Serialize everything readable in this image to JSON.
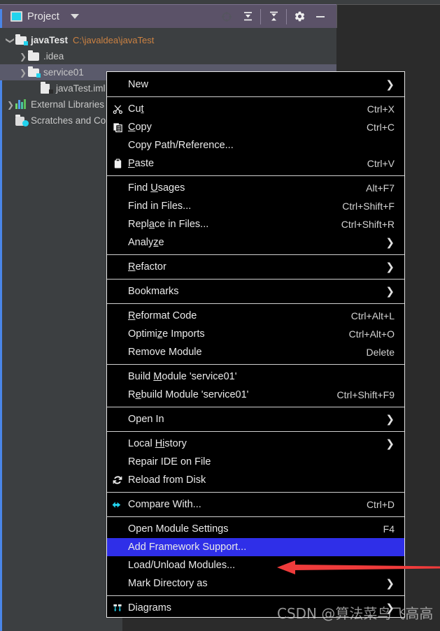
{
  "window": {
    "tool_window_title": "Project",
    "header_icons": [
      {
        "name": "locate-icon",
        "glyph": "target"
      },
      {
        "name": "collapse-all-icon",
        "glyph": "collapse"
      },
      {
        "name": "expand-all-icon",
        "glyph": "expand"
      },
      {
        "name": "settings-gear-icon",
        "glyph": "gear"
      },
      {
        "name": "hide-icon",
        "glyph": "minus"
      }
    ],
    "accent_color": "#4a86e8",
    "header_bg": "#5b5268",
    "panel_bg": "#3c3f41"
  },
  "project_tree": [
    {
      "label": "javaTest",
      "path": "C:\\javaldea\\javaTest",
      "icon": "module-folder-icon",
      "indent": 0,
      "chevron": "open",
      "bold": true,
      "selected": false
    },
    {
      "label": ".idea",
      "path": "",
      "icon": "folder-icon",
      "indent": 1,
      "chevron": "closed",
      "bold": false,
      "selected": false
    },
    {
      "label": "service01",
      "path": "",
      "icon": "module-folder-icon",
      "indent": 1,
      "chevron": "closed",
      "bold": false,
      "selected": true
    },
    {
      "label": "javaTest.iml",
      "path": "",
      "icon": "iml-file-icon",
      "indent": 2,
      "chevron": "none",
      "bold": false,
      "selected": false
    },
    {
      "label": "External Libraries",
      "path": "",
      "icon": "libraries-icon",
      "indent": 0,
      "chevron": "closed",
      "bold": false,
      "selected": false
    },
    {
      "label": "Scratches and Consoles",
      "path": "",
      "icon": "scratches-icon",
      "indent": 0,
      "chevron": "none",
      "bold": false,
      "selected": false
    }
  ],
  "context_menu": {
    "highlight_color": "#2f2fe8",
    "items": [
      {
        "label": "New",
        "shortcut": "",
        "icon": "",
        "submenu": true,
        "highlighted": false,
        "mnemonic": ""
      },
      {
        "separator": true
      },
      {
        "label": "Cut",
        "shortcut": "Ctrl+X",
        "icon": "scissors-icon",
        "submenu": false,
        "highlighted": false,
        "mnemonic": "t"
      },
      {
        "label": "Copy",
        "shortcut": "Ctrl+C",
        "icon": "copy-icon",
        "submenu": false,
        "highlighted": false,
        "mnemonic": "C"
      },
      {
        "label": "Copy Path/Reference...",
        "shortcut": "",
        "icon": "",
        "submenu": false,
        "highlighted": false,
        "mnemonic": ""
      },
      {
        "label": "Paste",
        "shortcut": "Ctrl+V",
        "icon": "clipboard-icon",
        "submenu": false,
        "highlighted": false,
        "mnemonic": "P"
      },
      {
        "separator": true
      },
      {
        "label": "Find Usages",
        "shortcut": "Alt+F7",
        "icon": "",
        "submenu": false,
        "highlighted": false,
        "mnemonic": "U"
      },
      {
        "label": "Find in Files...",
        "shortcut": "Ctrl+Shift+F",
        "icon": "",
        "submenu": false,
        "highlighted": false,
        "mnemonic": ""
      },
      {
        "label": "Replace in Files...",
        "shortcut": "Ctrl+Shift+R",
        "icon": "",
        "submenu": false,
        "highlighted": false,
        "mnemonic": "a"
      },
      {
        "label": "Analyze",
        "shortcut": "",
        "icon": "",
        "submenu": true,
        "highlighted": false,
        "mnemonic": "z"
      },
      {
        "separator": true
      },
      {
        "label": "Refactor",
        "shortcut": "",
        "icon": "",
        "submenu": true,
        "highlighted": false,
        "mnemonic": "R"
      },
      {
        "separator": true
      },
      {
        "label": "Bookmarks",
        "shortcut": "",
        "icon": "",
        "submenu": true,
        "highlighted": false,
        "mnemonic": ""
      },
      {
        "separator": true
      },
      {
        "label": "Reformat Code",
        "shortcut": "Ctrl+Alt+L",
        "icon": "",
        "submenu": false,
        "highlighted": false,
        "mnemonic": "R"
      },
      {
        "label": "Optimize Imports",
        "shortcut": "Ctrl+Alt+O",
        "icon": "",
        "submenu": false,
        "highlighted": false,
        "mnemonic": "z"
      },
      {
        "label": "Remove Module",
        "shortcut": "Delete",
        "icon": "",
        "submenu": false,
        "highlighted": false,
        "mnemonic": ""
      },
      {
        "separator": true
      },
      {
        "label": "Build Module 'service01'",
        "shortcut": "",
        "icon": "",
        "submenu": false,
        "highlighted": false,
        "mnemonic": "M"
      },
      {
        "label": "Rebuild Module 'service01'",
        "shortcut": "Ctrl+Shift+F9",
        "icon": "",
        "submenu": false,
        "highlighted": false,
        "mnemonic": "e"
      },
      {
        "separator": true
      },
      {
        "label": "Open In",
        "shortcut": "",
        "icon": "",
        "submenu": true,
        "highlighted": false,
        "mnemonic": ""
      },
      {
        "separator": true
      },
      {
        "label": "Local History",
        "shortcut": "",
        "icon": "",
        "submenu": true,
        "highlighted": false,
        "mnemonic": "Hi"
      },
      {
        "label": "Repair IDE on File",
        "shortcut": "",
        "icon": "",
        "submenu": false,
        "highlighted": false,
        "mnemonic": ""
      },
      {
        "label": "Reload from Disk",
        "shortcut": "",
        "icon": "reload-icon",
        "submenu": false,
        "highlighted": false,
        "mnemonic": ""
      },
      {
        "separator": true
      },
      {
        "label": "Compare With...",
        "shortcut": "Ctrl+D",
        "icon": "compare-icon",
        "submenu": false,
        "highlighted": false,
        "mnemonic": ""
      },
      {
        "separator": true
      },
      {
        "label": "Open Module Settings",
        "shortcut": "F4",
        "icon": "",
        "submenu": false,
        "highlighted": false,
        "mnemonic": ""
      },
      {
        "label": "Add Framework Support...",
        "shortcut": "",
        "icon": "",
        "submenu": false,
        "highlighted": true,
        "mnemonic": ""
      },
      {
        "label": "Load/Unload Modules...",
        "shortcut": "",
        "icon": "",
        "submenu": false,
        "highlighted": false,
        "mnemonic": ""
      },
      {
        "label": "Mark Directory as",
        "shortcut": "",
        "icon": "",
        "submenu": true,
        "highlighted": false,
        "mnemonic": ""
      },
      {
        "separator": true
      },
      {
        "label": "Diagrams",
        "shortcut": "",
        "icon": "diagram-icon",
        "submenu": true,
        "highlighted": false,
        "mnemonic": ""
      }
    ]
  },
  "annotation": {
    "arrow_color": "#ef3b3b",
    "points_to": "Add Framework Support..."
  },
  "watermark": {
    "text": "CSDN @算法菜鸟飞高高"
  }
}
